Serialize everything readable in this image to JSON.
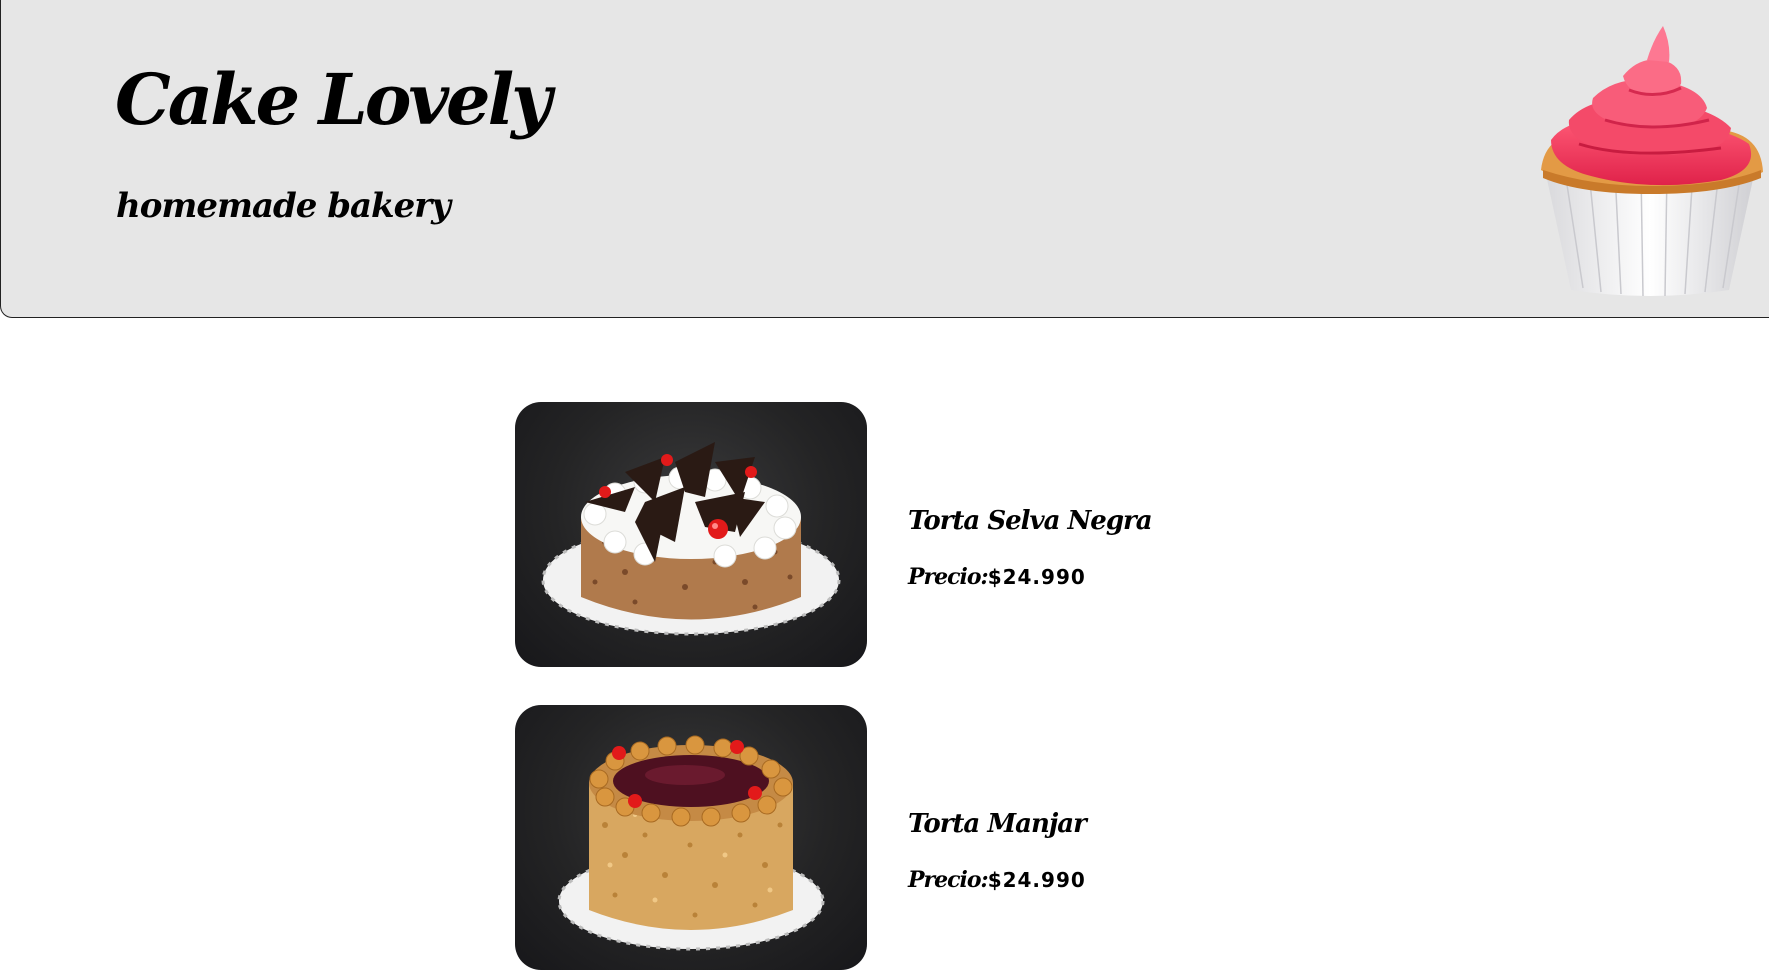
{
  "header": {
    "title": "Cake Lovely",
    "subtitle": "homemade bakery",
    "logo_icon": "cupcake-icon"
  },
  "products": [
    {
      "name": "Torta Selva Negra",
      "price_label": "Precio:",
      "price_value": "$24.990",
      "image_icon": "black-forest-cake-image"
    },
    {
      "name": "Torta Manjar",
      "price_label": "Precio:",
      "price_value": "$24.990",
      "image_icon": "manjar-cake-image"
    }
  ],
  "colors": {
    "header_bg": "#e6e6e6",
    "frosting": "#f03a5a",
    "photo_bg": "#242425"
  }
}
